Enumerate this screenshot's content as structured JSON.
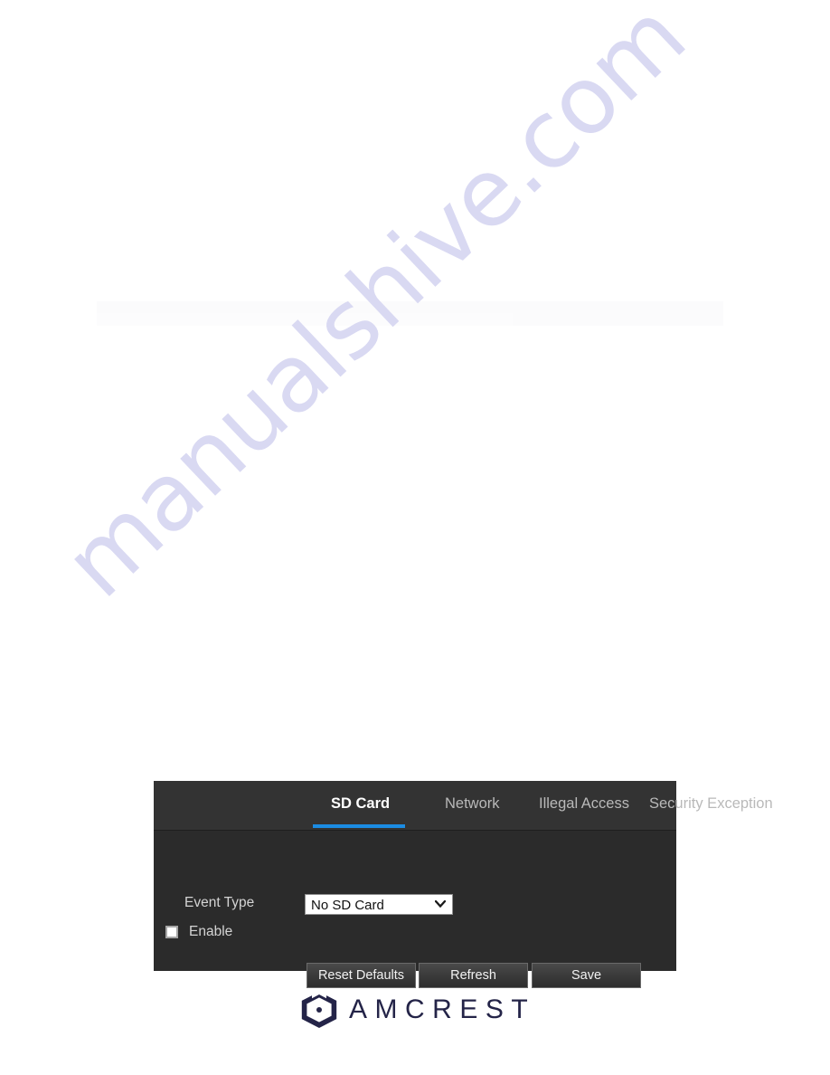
{
  "page": {
    "background_color": "#ffffff",
    "watermark_text": "manualshive.com",
    "watermark_color": "#d9d9f2"
  },
  "panel": {
    "background_color": "#2b2b2b",
    "tab_bar_color": "#333333",
    "accent_color": "#1b8ce3",
    "tabs": [
      {
        "label": "SD Card",
        "active": true
      },
      {
        "label": "Network",
        "active": false
      },
      {
        "label": "Illegal Access",
        "active": false
      },
      {
        "label": "Security Exception",
        "active": false
      }
    ],
    "form": {
      "event_type": {
        "label": "Event Type",
        "selected_value": "No SD Card",
        "options": [
          "No SD Card"
        ],
        "chevron_icon": "chevron-down-icon"
      },
      "enable": {
        "label": "Enable",
        "checked": false
      }
    },
    "buttons": [
      {
        "label": "Reset Defaults"
      },
      {
        "label": "Refresh"
      },
      {
        "label": "Save"
      }
    ]
  },
  "footer": {
    "brand": "AMCREST",
    "brand_color": "#242448",
    "mark_icon": "amcrest-hexagon-icon"
  }
}
